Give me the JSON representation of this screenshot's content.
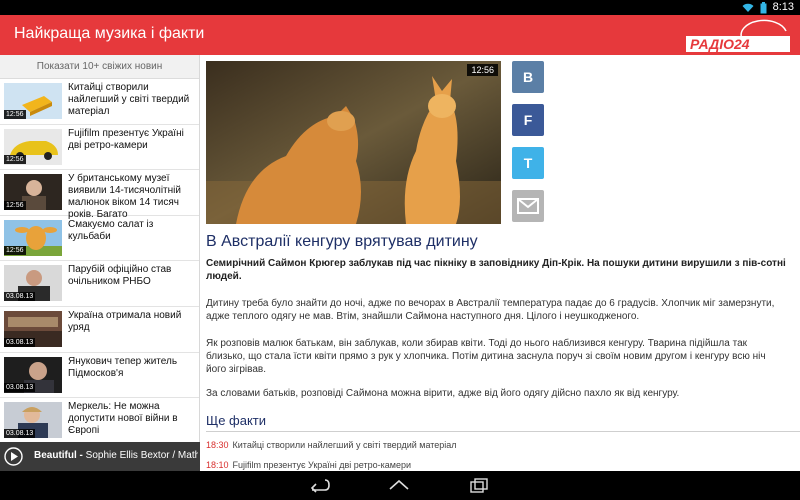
{
  "status": {
    "time": "8:13"
  },
  "app": {
    "title": "Найкраща музика і факти",
    "logo_text": "РАДІО24"
  },
  "sidebar": {
    "show_more": "Показати 10+ свіжих новин",
    "items": [
      {
        "time": "12:56",
        "title": "Китайці створили найлегший у світі твердий матеріал",
        "thumb": "sponge"
      },
      {
        "time": "12:56",
        "title": "Fujifilm презентує Україні дві ретро-камери",
        "thumb": "car"
      },
      {
        "time": "12:56",
        "title": "У британському музеї виявили 14-тисячолітній малюнок віком 14 тисяч років. Багато",
        "thumb": "person"
      },
      {
        "time": "12:56",
        "title": "Смакуємо салат із кульбаби",
        "thumb": "cow"
      },
      {
        "time": "03.08.13",
        "title": "Парубій офіційно став очільником РНБО",
        "thumb": "man"
      },
      {
        "time": "03.08.13",
        "title": "Україна отримала новий уряд",
        "thumb": "hall"
      },
      {
        "time": "03.08.13",
        "title": "Янукович тепер житель Підмосков'я",
        "thumb": "portrait"
      },
      {
        "time": "03.08.13",
        "title": "Меркель: Не можна допустити нової війни в Європі",
        "thumb": "woman"
      }
    ]
  },
  "player": {
    "artist": "Beautiful -",
    "track": " Sophie Ellis Bextor / Math"
  },
  "article": {
    "time": "12:56",
    "headline": "В Австралії кенгуру врятував дитину",
    "lead": "Семирічний Саймон Крюгер заблукав під час пікніку в заповіднику Діп-Крік. На пошуки дитини вирушили з пів-сотні людей.",
    "p1": "Дитину треба було знайти до ночі, адже по вечорах в Австралії температура падає до 6 градусів. Хлопчик міг замерзнути, адже теплого одягу не мав. Втім, знайшли Саймона наступного дня. Цілого і неушкодженого.",
    "p2": "Як розповів малюк батькам, він заблукав, коли збирав квіти. Тоді до нього наблизився кенгуру. Тварина підійшла так близько, що стала їсти квіти прямо з рук у хлопчика. Потім дитина заснула поруч зі своїм новим другом і кенгуру всю ніч його зігрівав.",
    "p3": "За словами батьків, розповіді Саймона можна вірити, адже від його одягу дійсно пахло як від кенгуру.",
    "facts_title": "Ще факти",
    "facts": [
      {
        "time": "18:30",
        "text": "Китайці створили найлегший у світі твердий матеріал"
      },
      {
        "time": "18:10",
        "text": "Fujifilm презентує Україні дві ретро-камери"
      }
    ]
  },
  "share": {
    "vk": "B",
    "fb": "F",
    "tw": "T"
  },
  "colors": {
    "header": "#e6393c",
    "headline": "#1e2f66",
    "fact_time": "#d9302e"
  }
}
